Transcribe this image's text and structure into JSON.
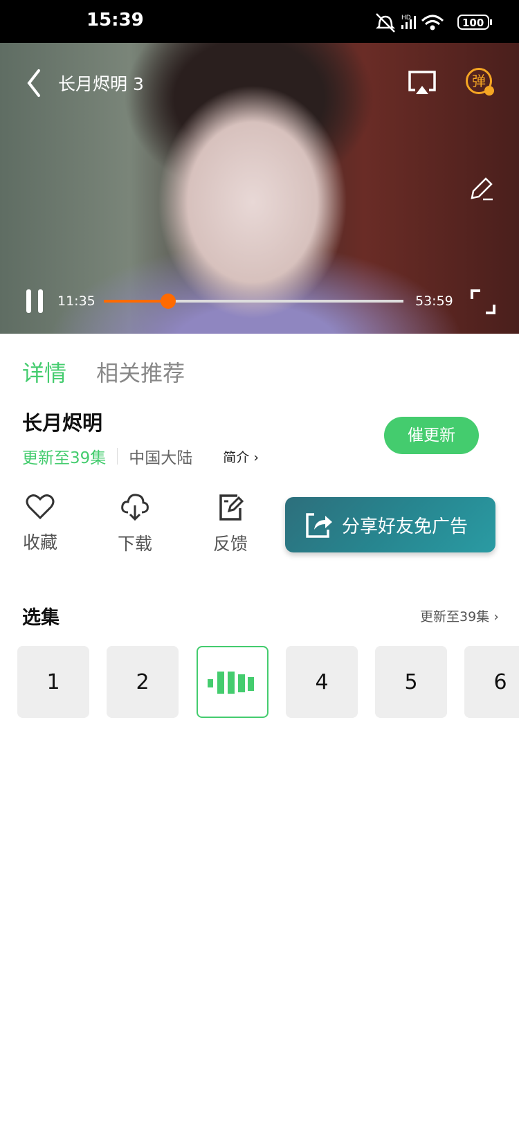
{
  "status_bar": {
    "time": "15:39",
    "battery": "100"
  },
  "player": {
    "title": "长月烬明 3",
    "current_time": "11:35",
    "duration": "53:59",
    "progress": 0.215,
    "danmaku_icon_label": "弹",
    "accent": "#ff6a00"
  },
  "tabs": [
    {
      "label": "详情",
      "active": true
    },
    {
      "label": "相关推荐",
      "active": false
    }
  ],
  "show": {
    "title": "长月烬明",
    "update_status": "更新至39集",
    "region": "中国大陆",
    "intro_label": "简介",
    "urge_button": "催更新"
  },
  "actions": [
    {
      "label": "收藏",
      "icon": "heart-icon"
    },
    {
      "label": "下载",
      "icon": "cloud-download-icon"
    },
    {
      "label": "反馈",
      "icon": "feedback-icon"
    }
  ],
  "share_button": "分享好友免广告",
  "episodes": {
    "title": "选集",
    "more_label": "更新至39集",
    "items": [
      "1",
      "2",
      "3",
      "4",
      "5",
      "6"
    ],
    "playing": "3"
  },
  "colors": {
    "green": "#44cc6e",
    "teal": "#27858f"
  }
}
